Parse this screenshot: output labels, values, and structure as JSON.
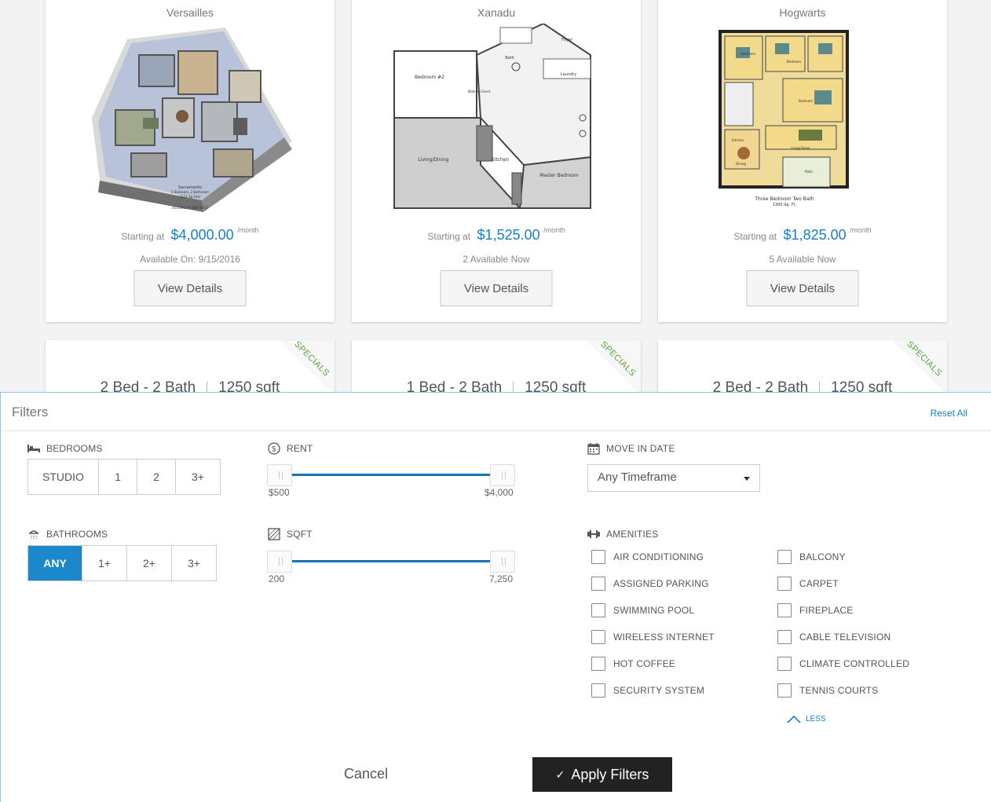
{
  "listings": [
    {
      "name": "Versailles",
      "starting_label": "Starting at",
      "price": "$4,000.00",
      "per": "/month",
      "availability": "Available On: 9/15/2016",
      "view_label": "View Details",
      "plan_style": "3d"
    },
    {
      "name": "Xanadu",
      "starting_label": "Starting at",
      "price": "$1,525.00",
      "per": "/month",
      "availability": "2 Available Now",
      "view_label": "View Details",
      "plan_style": "gray",
      "plan_text": {
        "bedroom2": "Bedroom #2",
        "living": "Living/Dining",
        "kitchen": "Kitchen",
        "master": "Master Bedroom",
        "foyer": "Foyer",
        "laundry": "Laundry",
        "walkin": "Walk-In Closet",
        "bath": "Bath"
      }
    },
    {
      "name": "Hogwarts",
      "starting_label": "Starting at",
      "price": "$1,825.00",
      "per": "/month",
      "availability": "5 Available Now",
      "view_label": "View Details",
      "plan_style": "color",
      "plan_caption": "Three Bedroom Two Bath",
      "plan_sub": "1300 Sq. Ft.",
      "plan_text": {
        "bedroom": "Bedroom",
        "kitchen": "Kitchen",
        "dining": "Dining",
        "living": "Living Room",
        "patio": "Patio"
      }
    }
  ],
  "listings_row2": [
    {
      "beds": "2 Bed - 2 Bath",
      "sqft": "1250 sqft",
      "ribbon": "SPECIALS"
    },
    {
      "beds": "1 Bed - 2 Bath",
      "sqft": "1250 sqft",
      "ribbon": "SPECIALS"
    },
    {
      "beds": "2 Bed - 2 Bath",
      "sqft": "1250 sqft",
      "ribbon": "SPECIALS"
    }
  ],
  "filters": {
    "title": "Filters",
    "reset_label": "Reset All",
    "bedrooms": {
      "label": "BEDROOMS",
      "options": [
        "STUDIO",
        "1",
        "2",
        "3+"
      ]
    },
    "bathrooms": {
      "label": "BATHROOMS",
      "options": [
        "ANY",
        "1+",
        "2+",
        "3+"
      ],
      "selected": "ANY"
    },
    "rent": {
      "label": "RENT",
      "min": "$500",
      "max": "$4,000"
    },
    "sqft": {
      "label": "SQFT",
      "min": "200",
      "max": "7,250"
    },
    "move_in": {
      "label": "MOVE IN DATE",
      "selected": "Any Timeframe"
    },
    "amenities": {
      "label": "AMENITIES",
      "left": [
        "AIR CONDITIONING",
        "ASSIGNED PARKING",
        "SWIMMING POOL",
        "WIRELESS INTERNET",
        "HOT COFFEE",
        "SECURITY SYSTEM"
      ],
      "right": [
        "BALCONY",
        "CARPET",
        "FIREPLACE",
        "CABLE TELEVISION",
        "CLIMATE CONTROLLED",
        "TENNIS COURTS"
      ],
      "less_label": "LESS"
    },
    "cancel_label": "Cancel",
    "apply_label": "Apply Filters"
  },
  "colors": {
    "accent": "#1b7fc0",
    "active": "#1b88cc",
    "apply_bg": "#222222",
    "specials": "#5aa43f"
  }
}
